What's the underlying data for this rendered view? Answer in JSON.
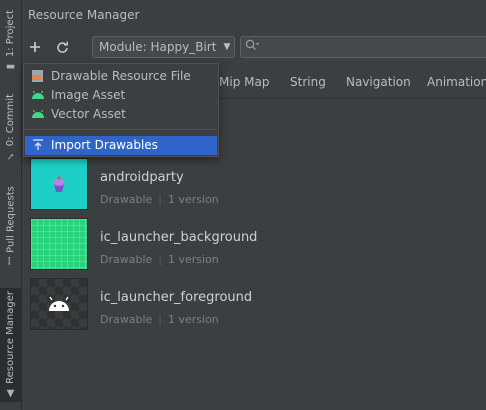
{
  "side_tabs": {
    "project": "1: Project",
    "commit": "0: Commit",
    "pull_requests": "Pull Requests",
    "resource_manager": "Resource Manager"
  },
  "title": "Resource Manager",
  "toolbar": {
    "add_icon": "plus-icon",
    "refresh_icon": "refresh-icon",
    "module_select": "Module: Happy_Birt",
    "search_placeholder": ""
  },
  "tabs": [
    "Mip Map",
    "String",
    "Navigation",
    "Animation"
  ],
  "dropdown_menu": {
    "items": [
      {
        "label": "Drawable Resource File",
        "icon": "drawable-file-icon"
      },
      {
        "label": "Image Asset",
        "icon": "android-icon"
      },
      {
        "label": "Vector Asset",
        "icon": "android-icon"
      },
      {
        "label": "Import Drawables",
        "icon": "import-icon",
        "selected": true
      }
    ]
  },
  "resources": [
    {
      "name": "androidparty",
      "type": "Drawable",
      "versions": "1 version"
    },
    {
      "name": "ic_launcher_background",
      "type": "Drawable",
      "versions": "1 version"
    },
    {
      "name": "ic_launcher_foreground",
      "type": "Drawable",
      "versions": "1 version"
    }
  ],
  "colors": {
    "background": "#3c3f41",
    "selection": "#2f65ca",
    "android_green": "#3ddc84",
    "androidparty_bg": "#1dcfc6",
    "launcher_bg": "#2bd27d"
  }
}
